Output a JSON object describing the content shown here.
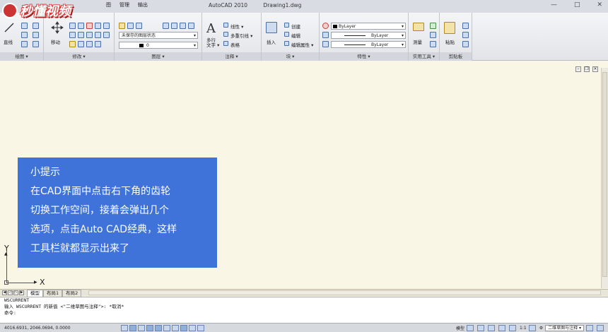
{
  "app": {
    "title": "AutoCAD 2010",
    "document": "Drawing1.dwg",
    "logo_text": "秒懂视频"
  },
  "menu": [
    "图",
    "管理",
    "输出"
  ],
  "window_controls": [
    "—",
    "□",
    "✕"
  ],
  "ribbon": {
    "panels": [
      {
        "label": "绘图 ▾"
      },
      {
        "label": "修改 ▾"
      },
      {
        "label": "图层 ▾"
      },
      {
        "label": "注释 ▾"
      },
      {
        "label": "块 ▾"
      },
      {
        "label": "特性 ▾"
      },
      {
        "label": "实用工具 ▾"
      },
      {
        "label": "剪贴板"
      }
    ],
    "draw": {
      "line": "直线"
    },
    "modify": {
      "move": "移动"
    },
    "layers": {
      "state": "未保存的图层状态",
      "layer": "0"
    },
    "annotation": {
      "mtext": "多行\n文字 ▾",
      "linear": "线性 ▾",
      "multileader": "多重引线 ▾",
      "table": "表格"
    },
    "block": {
      "insert": "插入",
      "create": "创建",
      "edit": "编辑",
      "attrs": "编辑属性 ▾"
    },
    "properties": {
      "color": "ByLayer",
      "linetype": "ByLayer",
      "lineweight": "ByLayer"
    },
    "utilities": {
      "measure": "测量"
    },
    "clipboard": {
      "paste": "粘贴"
    }
  },
  "tip": {
    "lines": [
      "小提示",
      "在CAD界面中点击右下角的齿轮",
      "切换工作空间，接着会弹出几个",
      "选项，点击Auto CAD经典，这样",
      "工具栏就都显示出来了"
    ]
  },
  "ucs": {
    "x": "X",
    "y": "Y"
  },
  "layout_tabs": [
    "模型",
    "布局1",
    "布局2"
  ],
  "command": {
    "lines": [
      "WSCURRENT",
      "输入 WSCURRENT 的新值 <\"二维草图与注释\">: *取消*",
      "命令:"
    ]
  },
  "status": {
    "coords": "4016.6931, 2046.0694, 0.0000",
    "model": "模型",
    "scale": "1:1",
    "workspace": "二维草图与注释 ▾"
  },
  "colors": {
    "tip_bg": "#3f73d9",
    "canvas": "#faf6e6"
  }
}
